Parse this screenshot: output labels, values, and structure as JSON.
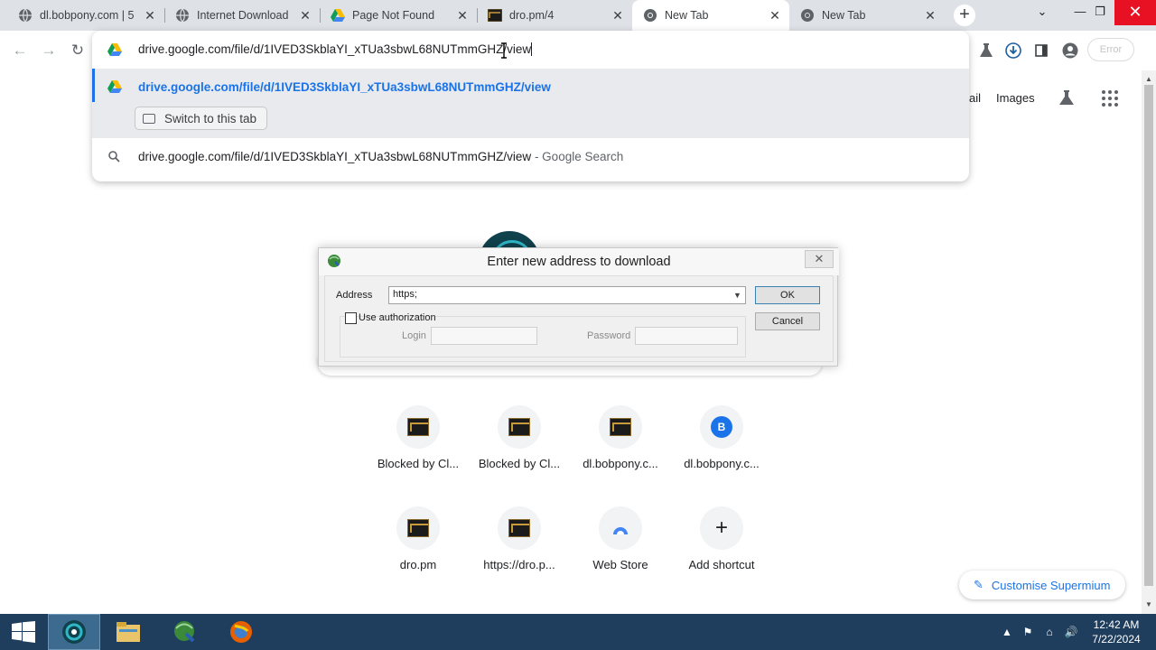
{
  "tabs": [
    {
      "title": "dl.bobpony.com | 5",
      "favicon": "globe-icon",
      "active": false
    },
    {
      "title": "Internet Download",
      "favicon": "globe-icon",
      "active": false
    },
    {
      "title": "Page Not Found",
      "favicon": "google-drive-icon",
      "active": false
    },
    {
      "title": "dro.pm/4",
      "favicon": "dropm-icon",
      "active": false
    },
    {
      "title": "New Tab",
      "favicon": "chromium-icon",
      "active": true
    },
    {
      "title": "New Tab",
      "favicon": "chromium-icon",
      "active": false
    }
  ],
  "omnibox": {
    "input_value": "drive.google.com/file/d/1IVED3SkblaYI_xTUa3sbwL68NUTmmGHZ/view",
    "suggestion_url": "drive.google.com/file/d/1IVED3SkblaYI_xTUa3sbwL68NUTmmGHZ/view",
    "switch_tab_label": "Switch to this tab",
    "search_query": "drive.google.com/file/d/1IVED3SkblaYI_xTUa3sbwL68NUTmmGHZ/view",
    "search_suffix": "- Google Search"
  },
  "toolbar": {
    "error_label": "Error"
  },
  "google_header": {
    "gmail": "ail",
    "images": "Images"
  },
  "dialog": {
    "title": "Enter new address to download",
    "address_label": "Address",
    "address_value": "https;",
    "use_auth_label": "Use authorization",
    "use_auth_checked": false,
    "login_label": "Login",
    "password_label": "Password",
    "ok_label": "OK",
    "cancel_label": "Cancel"
  },
  "shortcuts": [
    {
      "label": "Blocked by Cl...",
      "icon": "dropm-icon"
    },
    {
      "label": "Blocked by Cl...",
      "icon": "dropm-icon"
    },
    {
      "label": "dl.bobpony.c...",
      "icon": "dropm-icon"
    },
    {
      "label": "dl.bobpony.c...",
      "icon": "letter-badge",
      "badge": "B"
    },
    {
      "label": "dro.pm",
      "icon": "dropm-icon"
    },
    {
      "label": "https://dro.p...",
      "icon": "dropm-icon"
    },
    {
      "label": "Web Store",
      "icon": "web-store-icon"
    },
    {
      "label": "Add shortcut",
      "icon": "plus-icon"
    }
  ],
  "customise_label": "Customise Supermium",
  "taskbar": {
    "time": "12:42 AM",
    "date": "7/22/2024"
  },
  "colors": {
    "accent": "#1a73e8",
    "tabstrip_bg": "#dee1e6",
    "taskbar_bg": "#1f3e5e"
  }
}
